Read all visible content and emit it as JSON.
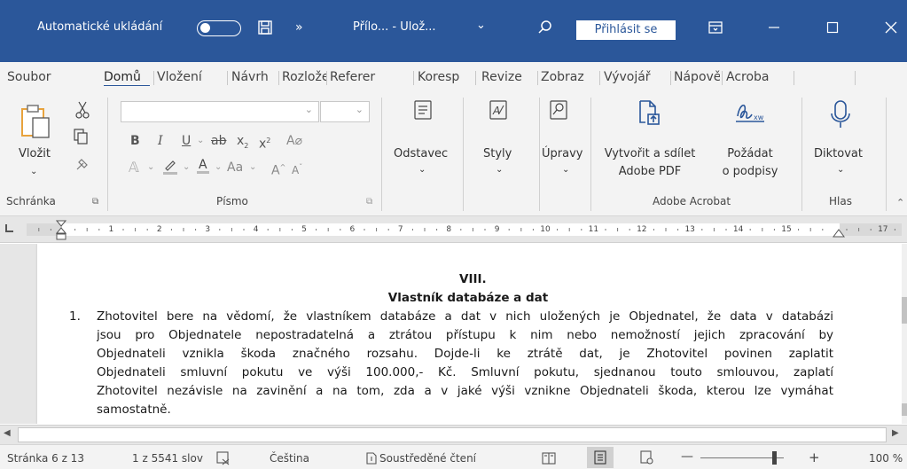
{
  "titlebar": {
    "autosave_label": "Automatické ukládání",
    "more": "»",
    "doc_title": "Přílo... - Ulož...",
    "doc_title_caret": "⌄",
    "signin": "Přihlásit se",
    "accent": "#2b579a"
  },
  "tabs": [
    {
      "label": "Soubor"
    },
    {
      "label": "Domů"
    },
    {
      "label": "Vložení"
    },
    {
      "label": "Návrh"
    },
    {
      "label": "Rozlože"
    },
    {
      "label": "Referer"
    },
    {
      "label": "Koresp"
    },
    {
      "label": "Revize"
    },
    {
      "label": "Zobraz"
    },
    {
      "label": "Vývojář"
    },
    {
      "label": "Nápově"
    },
    {
      "label": "Acroba"
    }
  ],
  "ribbon": {
    "paste": "Vložit",
    "clipboard_group": "Schránka",
    "font_group": "Písmo",
    "font_size_btn": "Aa",
    "paragraph": "Odstavec",
    "styles": "Styly",
    "editing": "Úpravy",
    "create_pdf_line1": "Vytvořit a sdílet",
    "create_pdf_line2": "Adobe PDF",
    "request_sig_line1": "Požádat",
    "request_sig_line2": "o podpisy",
    "acrobat_group": "Adobe Acrobat",
    "dictate": "Diktovat",
    "voice_group": "Hlas"
  },
  "ruler": {
    "labels": [
      "1",
      "2",
      "3",
      "4",
      "5",
      "6",
      "7",
      "8",
      "9",
      "10",
      "11",
      "12",
      "13",
      "14",
      "15",
      "17"
    ]
  },
  "document": {
    "heading": "VIII.",
    "subheading": "Vlastník databáze a dat",
    "item_number": "1.",
    "lines": [
      "Zhotovitel bere na vědomí, že vlastníkem databáze a dat v nich uložených je Objednatel, že data v databázi",
      "jsou pro Objednatele nepostradatelná a ztrátou přístupu k nim nebo nemožností jejich zpracování by",
      "Objednateli vznikla škoda značného rozsahu. Dojde-li ke ztrátě dat, je Zhotovitel povinen zaplatit",
      "Objednateli smluvní pokutu ve výši 100.000,- Kč. Smluvní pokutu, sjednanou touto smlouvou, zaplatí",
      "Zhotovitel nezávisle na zavinění a na tom, zda a v jaké výši vznikne Objednateli škoda, kterou lze vymáhat",
      "samostatně."
    ]
  },
  "status": {
    "page": "Stránka 6 z 13",
    "words": "1 z 5541 slov",
    "language": "Čeština",
    "focus": "Soustředěné čtení",
    "zoom": "100 %",
    "zoom_minus": "—",
    "zoom_plus": "+"
  }
}
